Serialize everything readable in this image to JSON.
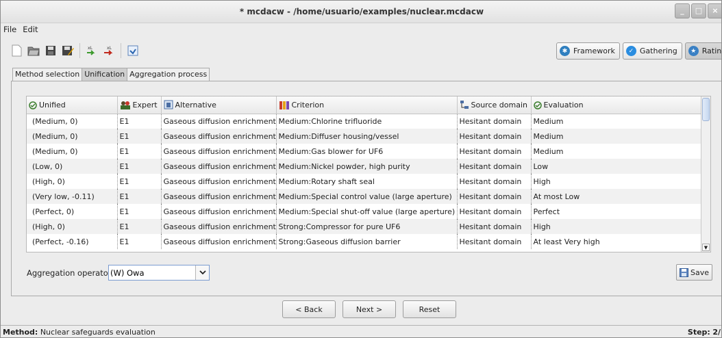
{
  "window": {
    "title": "* mcdacw - /home/usuario/examples/nuclear.mcdacw"
  },
  "menu": {
    "file": "File",
    "edit": "Edit"
  },
  "perspectives": [
    {
      "label": "Framework",
      "color": "#2f7fbf",
      "icon": "framework-icon"
    },
    {
      "label": "Gathering",
      "color": "#2a8de0",
      "icon": "check-icon"
    },
    {
      "label": "Rating",
      "color": "#3a80c4",
      "icon": "star-icon"
    }
  ],
  "tabs": [
    "Method selection",
    "Unification",
    "Aggregation process"
  ],
  "table": {
    "headers": [
      "Unified",
      "Expert",
      "Alternative",
      "Criterion",
      "Source domain",
      "Evaluation"
    ],
    "rows": [
      [
        "(Medium, 0)",
        "E1",
        "Gaseous diffusion enrichment",
        "Medium:Chlorine trifluoride",
        "Hesitant domain",
        "Medium"
      ],
      [
        "(Medium, 0)",
        "E1",
        "Gaseous diffusion enrichment",
        "Medium:Diffuser housing/vessel",
        "Hesitant domain",
        "Medium"
      ],
      [
        "(Medium, 0)",
        "E1",
        "Gaseous diffusion enrichment",
        "Medium:Gas blower for UF6",
        "Hesitant domain",
        "Medium"
      ],
      [
        "(Low, 0)",
        "E1",
        "Gaseous diffusion enrichment",
        "Medium:Nickel powder, high purity",
        "Hesitant domain",
        "Low"
      ],
      [
        "(High, 0)",
        "E1",
        "Gaseous diffusion enrichment",
        "Medium:Rotary shaft seal",
        "Hesitant domain",
        "High"
      ],
      [
        "(Very low, -0.11)",
        "E1",
        "Gaseous diffusion enrichment",
        "Medium:Special control value (large aperture)",
        "Hesitant domain",
        "At most Low"
      ],
      [
        "(Perfect, 0)",
        "E1",
        "Gaseous diffusion enrichment",
        "Medium:Special shut-off value (large aperture)",
        "Hesitant domain",
        "Perfect"
      ],
      [
        "(High, 0)",
        "E1",
        "Gaseous diffusion enrichment",
        "Strong:Compressor for pure UF6",
        "Hesitant domain",
        "High"
      ],
      [
        "(Perfect, -0.16)",
        "E1",
        "Gaseous diffusion enrichment",
        "Strong:Gaseous diffusion barrier",
        "Hesitant domain",
        "At least Very high"
      ]
    ]
  },
  "aggregation": {
    "label": "Aggregation operator",
    "value": "(W) Owa"
  },
  "buttons": {
    "save": "Save",
    "back": "< Back",
    "next": "Next >",
    "reset": "Reset"
  },
  "status": {
    "method_label": "Method:",
    "method_value": "Nuclear safeguards evaluation",
    "step_label": "Step:",
    "step_value": "2/"
  }
}
